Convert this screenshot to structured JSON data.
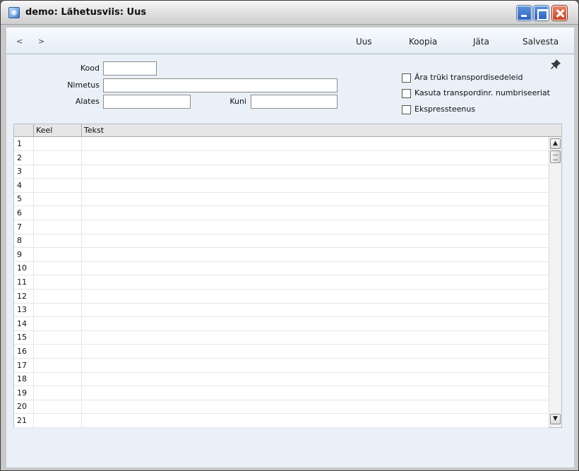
{
  "window": {
    "title": "demo: Lähetusviis: Uus"
  },
  "toolbar": {
    "prev": "<",
    "next": ">",
    "buttons": {
      "new": "Uus",
      "copy": "Koopia",
      "skip": "Jäta",
      "save": "Salvesta"
    }
  },
  "form": {
    "kood_label": "Kood",
    "kood_value": "",
    "nimetus_label": "Nimetus",
    "nimetus_value": "",
    "alates_label": "Alates",
    "alates_value": "",
    "kuni_label": "Kuni",
    "kuni_value": ""
  },
  "options": [
    {
      "label": "Ära trüki transpordisedeleid",
      "checked": false
    },
    {
      "label": "Kasuta transpordinr. numbriseeriat",
      "checked": false
    },
    {
      "label": "Ekspressteenus",
      "checked": false
    }
  ],
  "grid": {
    "columns": [
      "Keel",
      "Tekst"
    ],
    "rows": [
      "1",
      "2",
      "3",
      "4",
      "5",
      "6",
      "7",
      "8",
      "9",
      "10",
      "11",
      "12",
      "13",
      "14",
      "15",
      "16",
      "17",
      "18",
      "19",
      "20",
      "21"
    ]
  },
  "icons": {
    "pin": "pin-icon",
    "app": "app-icon"
  },
  "colors": {
    "panel": "#e9f0f8",
    "toolbar": "#e4ecf5",
    "window_bg": "#c9c9c9"
  }
}
